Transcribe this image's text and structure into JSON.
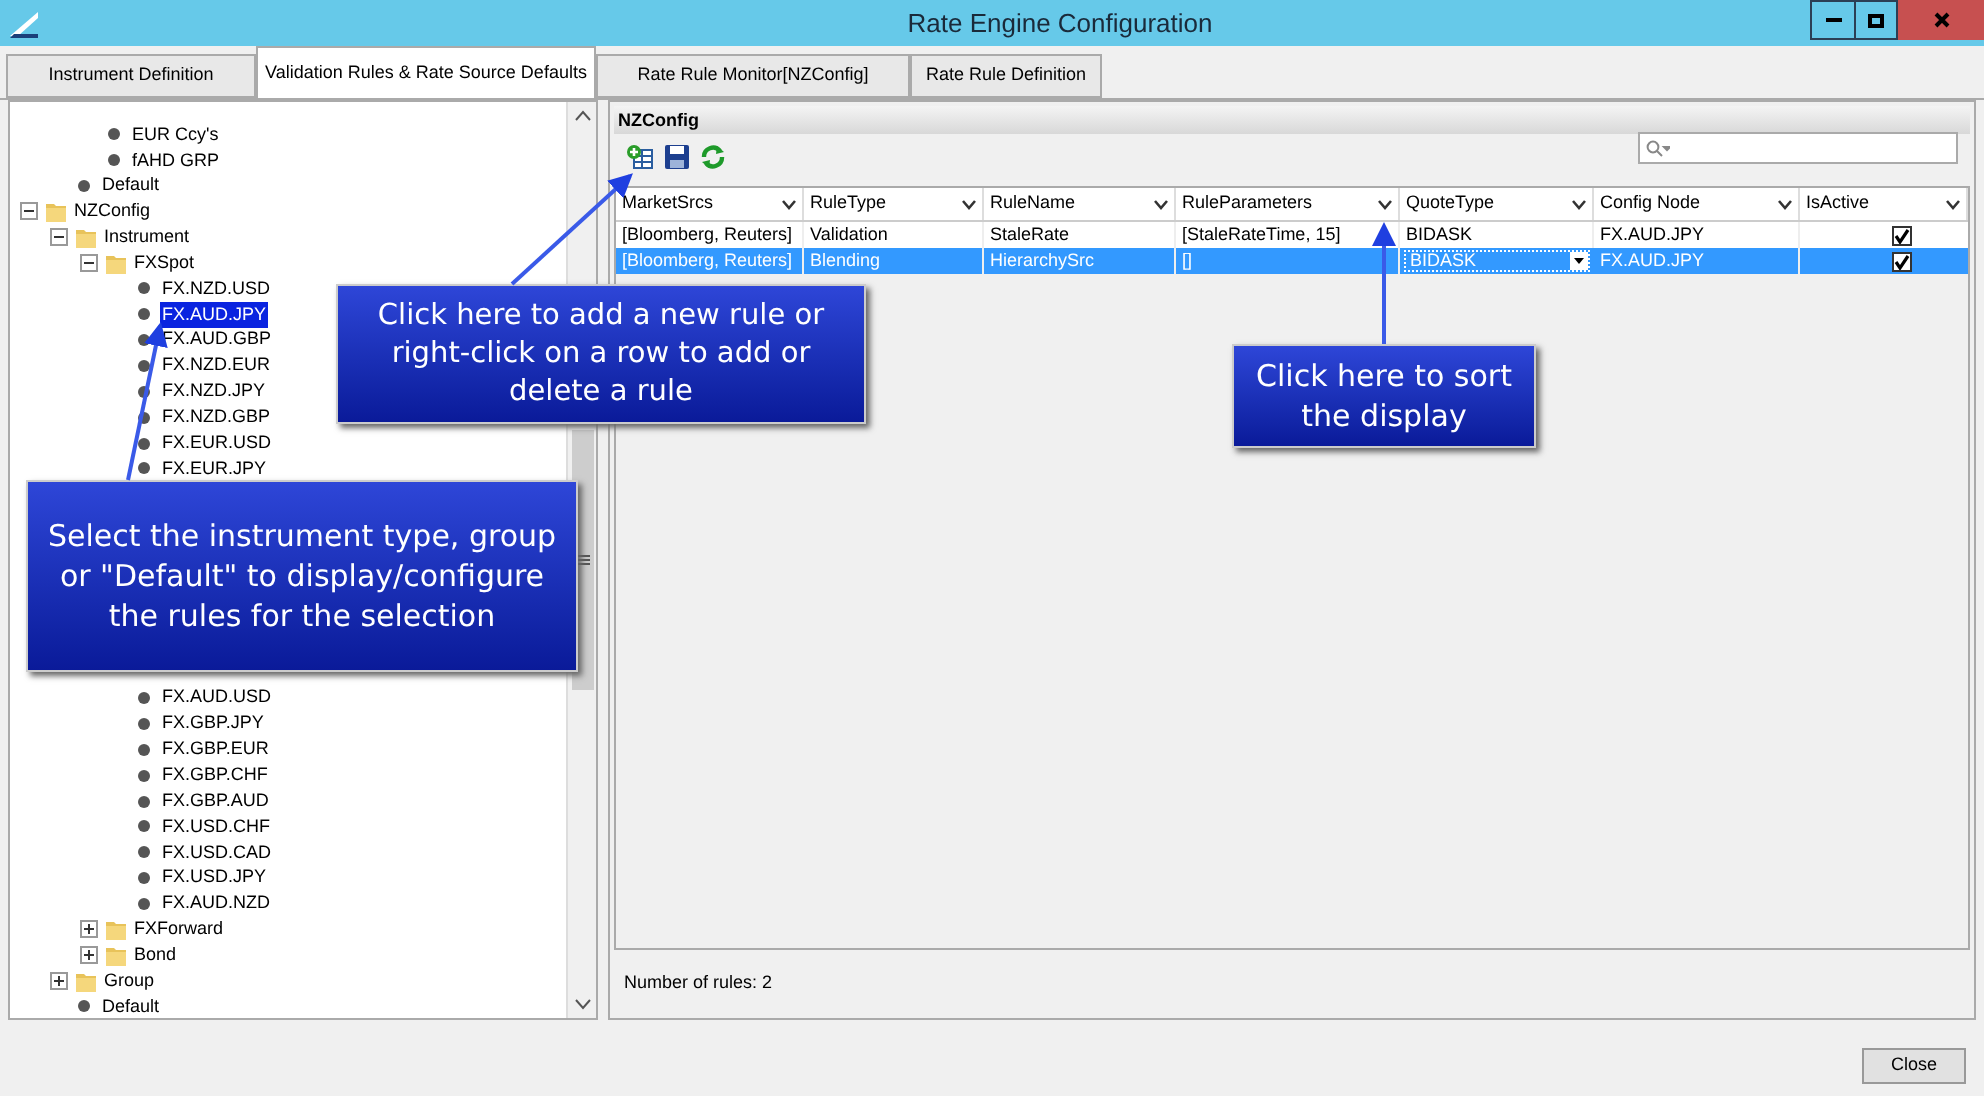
{
  "window": {
    "title": "Rate Engine Configuration"
  },
  "tabs": [
    {
      "label": "Instrument Definition",
      "selected": false
    },
    {
      "label": "Validation Rules & Rate Source Defaults",
      "selected": true
    },
    {
      "label": "Rate Rule Monitor[NZConfig]",
      "selected": false
    },
    {
      "label": "Rate Rule Definition",
      "selected": false
    }
  ],
  "tree": [
    {
      "kind": "offscreen",
      "children": [
        {
          "kind": "offscreen",
          "children": [
            {
              "label": "EUR Ccy's",
              "kind": "leaf",
              "selected": false
            },
            {
              "label": "fAHD GRP",
              "kind": "leaf",
              "selected": false
            }
          ]
        },
        {
          "label": "Default",
          "kind": "leaf",
          "selected": false
        }
      ]
    },
    {
      "label": "NZConfig",
      "kind": "folder",
      "expanded": true,
      "children": [
        {
          "label": "Instrument",
          "kind": "folder",
          "expanded": true,
          "children": [
            {
              "label": "FXSpot",
              "kind": "folder",
              "expanded": true,
              "children": [
                {
                  "label": "FX.NZD.USD",
                  "kind": "leaf",
                  "selected": false
                },
                {
                  "label": "FX.AUD.JPY",
                  "kind": "leaf",
                  "selected": true
                },
                {
                  "label": "FX.AUD.GBP",
                  "kind": "leaf",
                  "selected": false
                },
                {
                  "label": "FX.NZD.EUR",
                  "kind": "leaf",
                  "selected": false
                },
                {
                  "label": "FX.NZD.JPY",
                  "kind": "leaf",
                  "selected": false
                },
                {
                  "label": "FX.NZD.GBP",
                  "kind": "leaf",
                  "selected": false
                },
                {
                  "label": "FX.EUR.USD",
                  "kind": "leaf",
                  "selected": false
                },
                {
                  "label": "FX.EUR.JPY",
                  "kind": "leaf",
                  "selected": false
                },
                {
                  "label": "FX.AUD.USD",
                  "kind": "leaf",
                  "selected": false
                },
                {
                  "label": "FX.GBP.JPY",
                  "kind": "leaf",
                  "selected": false
                },
                {
                  "label": "FX.GBP.EUR",
                  "kind": "leaf",
                  "selected": false
                },
                {
                  "label": "FX.GBP.CHF",
                  "kind": "leaf",
                  "selected": false
                },
                {
                  "label": "FX.GBP.AUD",
                  "kind": "leaf",
                  "selected": false
                },
                {
                  "label": "FX.USD.CHF",
                  "kind": "leaf",
                  "selected": false
                },
                {
                  "label": "FX.USD.CAD",
                  "kind": "leaf",
                  "selected": false
                },
                {
                  "label": "FX.USD.JPY",
                  "kind": "leaf",
                  "selected": false
                },
                {
                  "label": "FX.AUD.NZD",
                  "kind": "leaf",
                  "selected": false
                }
              ]
            },
            {
              "label": "FXForward",
              "kind": "folder",
              "expanded": false
            },
            {
              "label": "Bond",
              "kind": "folder",
              "expanded": false
            }
          ]
        },
        {
          "label": "Group",
          "kind": "folder",
          "expanded": false
        },
        {
          "label": "Default",
          "kind": "leaf",
          "selected": false
        }
      ]
    }
  ],
  "panel": {
    "title": "NZConfig"
  },
  "table": {
    "columns": [
      "MarketSrcs",
      "RuleType",
      "RuleName",
      "RuleParameters",
      "QuoteType",
      "Config Node",
      "IsActive"
    ],
    "rows": [
      {
        "cells": [
          "[Bloomberg, Reuters]",
          "Validation",
          "StaleRate",
          "[StaleRateTime, 15]",
          "BIDASK",
          "FX.AUD.JPY"
        ],
        "active": true,
        "selected": false,
        "editing": false
      },
      {
        "cells": [
          "[Bloomberg, Reuters]",
          "Blending",
          "HierarchySrc",
          "[]",
          "BIDASK",
          "FX.AUD.JPY"
        ],
        "active": true,
        "selected": true,
        "editing": true
      }
    ]
  },
  "status": "Number of rules: 2",
  "callouts": [
    "Click here to add a new rule or right-click on a row to add or delete a rule",
    "Select the instrument type, group or \"Default\" to display/configure the rules for the selection",
    "Click here to sort the display"
  ],
  "close_button": "Close"
}
